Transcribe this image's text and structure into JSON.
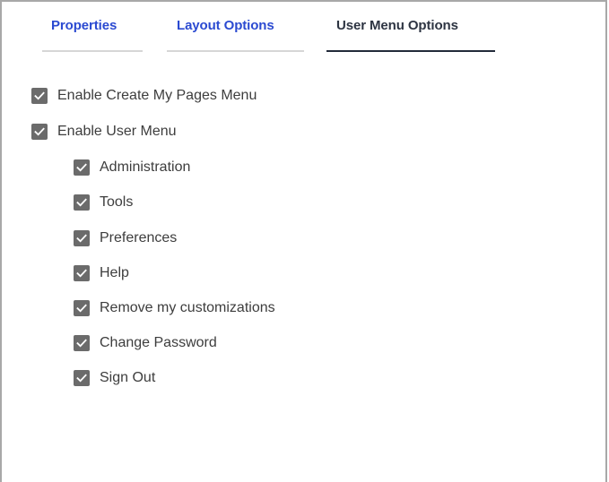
{
  "tabs": [
    {
      "label": "Properties",
      "active": false
    },
    {
      "label": "Layout Options",
      "active": false
    },
    {
      "label": "User Menu Options",
      "active": true
    }
  ],
  "options": {
    "enable_create_my_pages": {
      "label": "Enable Create My Pages Menu",
      "checked": true
    },
    "enable_user_menu": {
      "label": "Enable User Menu",
      "checked": true
    },
    "sub_items": [
      {
        "label": "Administration",
        "checked": true
      },
      {
        "label": "Tools",
        "checked": true
      },
      {
        "label": "Preferences",
        "checked": true
      },
      {
        "label": "Help",
        "checked": true
      },
      {
        "label": "Remove my customizations",
        "checked": true
      },
      {
        "label": "Change Password",
        "checked": true
      },
      {
        "label": "Sign Out",
        "checked": true
      }
    ]
  },
  "colors": {
    "tab_inactive": "#2b4ad1",
    "tab_active": "#2d3442",
    "checkbox_fill": "#6b6b6b",
    "text": "#3d3d3d"
  }
}
